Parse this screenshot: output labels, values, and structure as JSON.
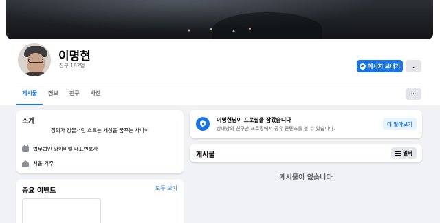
{
  "profile": {
    "name": "이명현",
    "friends": "친구 182명"
  },
  "actions": {
    "message_label": "메시지 보내기",
    "more_label": "⌄"
  },
  "tabs": [
    {
      "label": "게시물",
      "active": true
    },
    {
      "label": "정보",
      "active": false
    },
    {
      "label": "친구",
      "active": false
    },
    {
      "label": "사진",
      "active": false
    }
  ],
  "tab_more_label": "···",
  "intro": {
    "title": "소개",
    "bio": "정의가 강물처럼 흐르는 세상을 꿈꾸는 사나이",
    "work": "법무법인 와이비엘 대표변호사",
    "home": "서울 거주"
  },
  "events": {
    "title": "중요 이벤트",
    "see_all": "모두 보기"
  },
  "locked": {
    "title": "이명현님이 프로필을 잠갔습니다",
    "description": "상대방의 친구만 프로필에서 공유 콘텐츠를 볼 수 있습니다.",
    "learn_more": "더 알아보기"
  },
  "posts": {
    "title": "게시물",
    "filter_label": "필터",
    "empty_text": "게시물이 없습니다"
  },
  "colors": {
    "accent": "#1b74e4",
    "background": "#f0f2f5",
    "secondary_text": "#65676b"
  }
}
